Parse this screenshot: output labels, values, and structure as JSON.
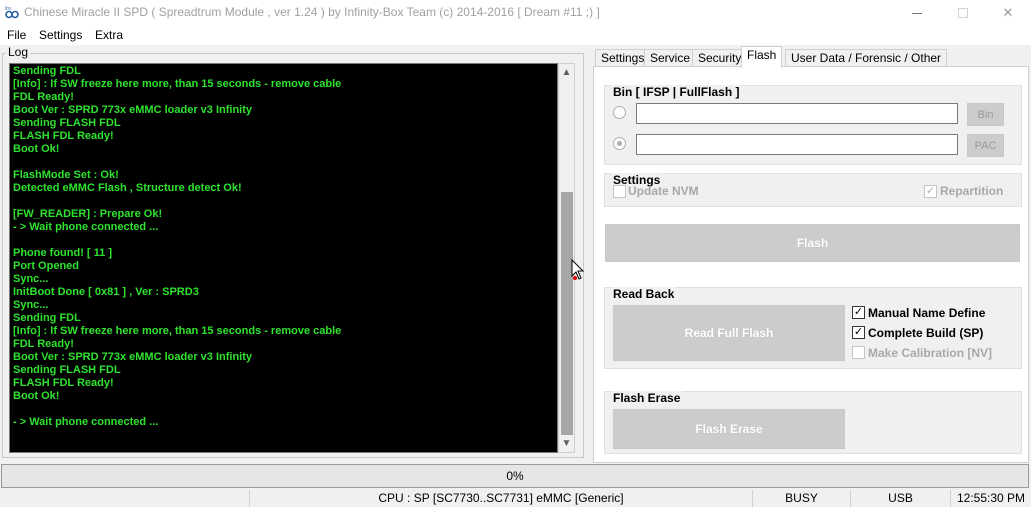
{
  "window": {
    "title": "Chinese Miracle II SPD ( Spreadtrum Module , ver 1.24 ) by Infinity-Box Team (c) 2014-2016 [ Dream #11 ;) ]",
    "minimize_symbol": "—",
    "close_symbol": "✕"
  },
  "menu": {
    "file": "File",
    "settings": "Settings",
    "extra": "Extra"
  },
  "log": {
    "label": "Log",
    "lines": [
      "Sending FDL",
      "[Info] : If SW freeze here more, than 15 seconds - remove cable",
      "FDL Ready!",
      "Boot Ver : SPRD 773x eMMC loader v3 Infinity",
      "Sending FLASH FDL",
      "FLASH FDL Ready!",
      "Boot Ok!",
      "",
      "FlashMode Set : Ok!",
      "Detected eMMC Flash , Structure detect Ok!",
      "",
      "[FW_READER] : Prepare Ok!",
      "- > Wait phone connected ...",
      "",
      "Phone found! [ 11 ]",
      "Port Opened",
      "Sync...",
      "InitBoot Done [ 0x81 ] , Ver : SPRD3",
      "Sync...",
      "Sending FDL",
      "[Info] : If SW freeze here more, than 15 seconds - remove cable",
      "FDL Ready!",
      "Boot Ver : SPRD 773x eMMC loader v3 Infinity",
      "Sending FLASH FDL",
      "FLASH FDL Ready!",
      "Boot Ok!",
      "",
      "- > Wait phone connected ..."
    ],
    "text_color": "#2fe22f"
  },
  "tabs": [
    "Settings",
    "Service",
    "Security",
    "Flash",
    "User Data / Forensic / Other"
  ],
  "active_tab": "Flash",
  "flash": {
    "bin_group": {
      "title": "Bin  [ IFSP | FullFlash ]",
      "bin_value": "",
      "pac_value": "",
      "bin_button": "Bin",
      "pac_button": "PAC",
      "selected": "pac"
    },
    "settings_group": {
      "title": "Settings",
      "update_nvm": {
        "label": "Update NVM",
        "checked": false,
        "enabled": false
      },
      "repartition": {
        "label": "Repartition",
        "checked": true,
        "enabled": false
      }
    },
    "flash_button": "Flash",
    "read_back": {
      "title": "Read Back",
      "read_button": "Read Full Flash",
      "manual_name": {
        "label": "Manual Name Define",
        "checked": true
      },
      "complete_build": {
        "label": "Complete Build (SP)",
        "checked": true
      },
      "make_calibration": {
        "label": "Make Calibration [NV]",
        "checked": false,
        "enabled": false
      }
    },
    "flash_erase": {
      "title": "Flash Erase",
      "button": "Flash Erase"
    }
  },
  "progress": {
    "text": "0%",
    "value": 0
  },
  "status": {
    "cpu": "CPU : SP [SC7730..SC7731] eMMC [Generic]",
    "state": "BUSY",
    "port": "USB",
    "time": "12:55:30 PM"
  },
  "icons": {
    "app": "infinity-logo-icon",
    "scroll_up": "▲",
    "scroll_down": "▼",
    "check": "✓"
  }
}
